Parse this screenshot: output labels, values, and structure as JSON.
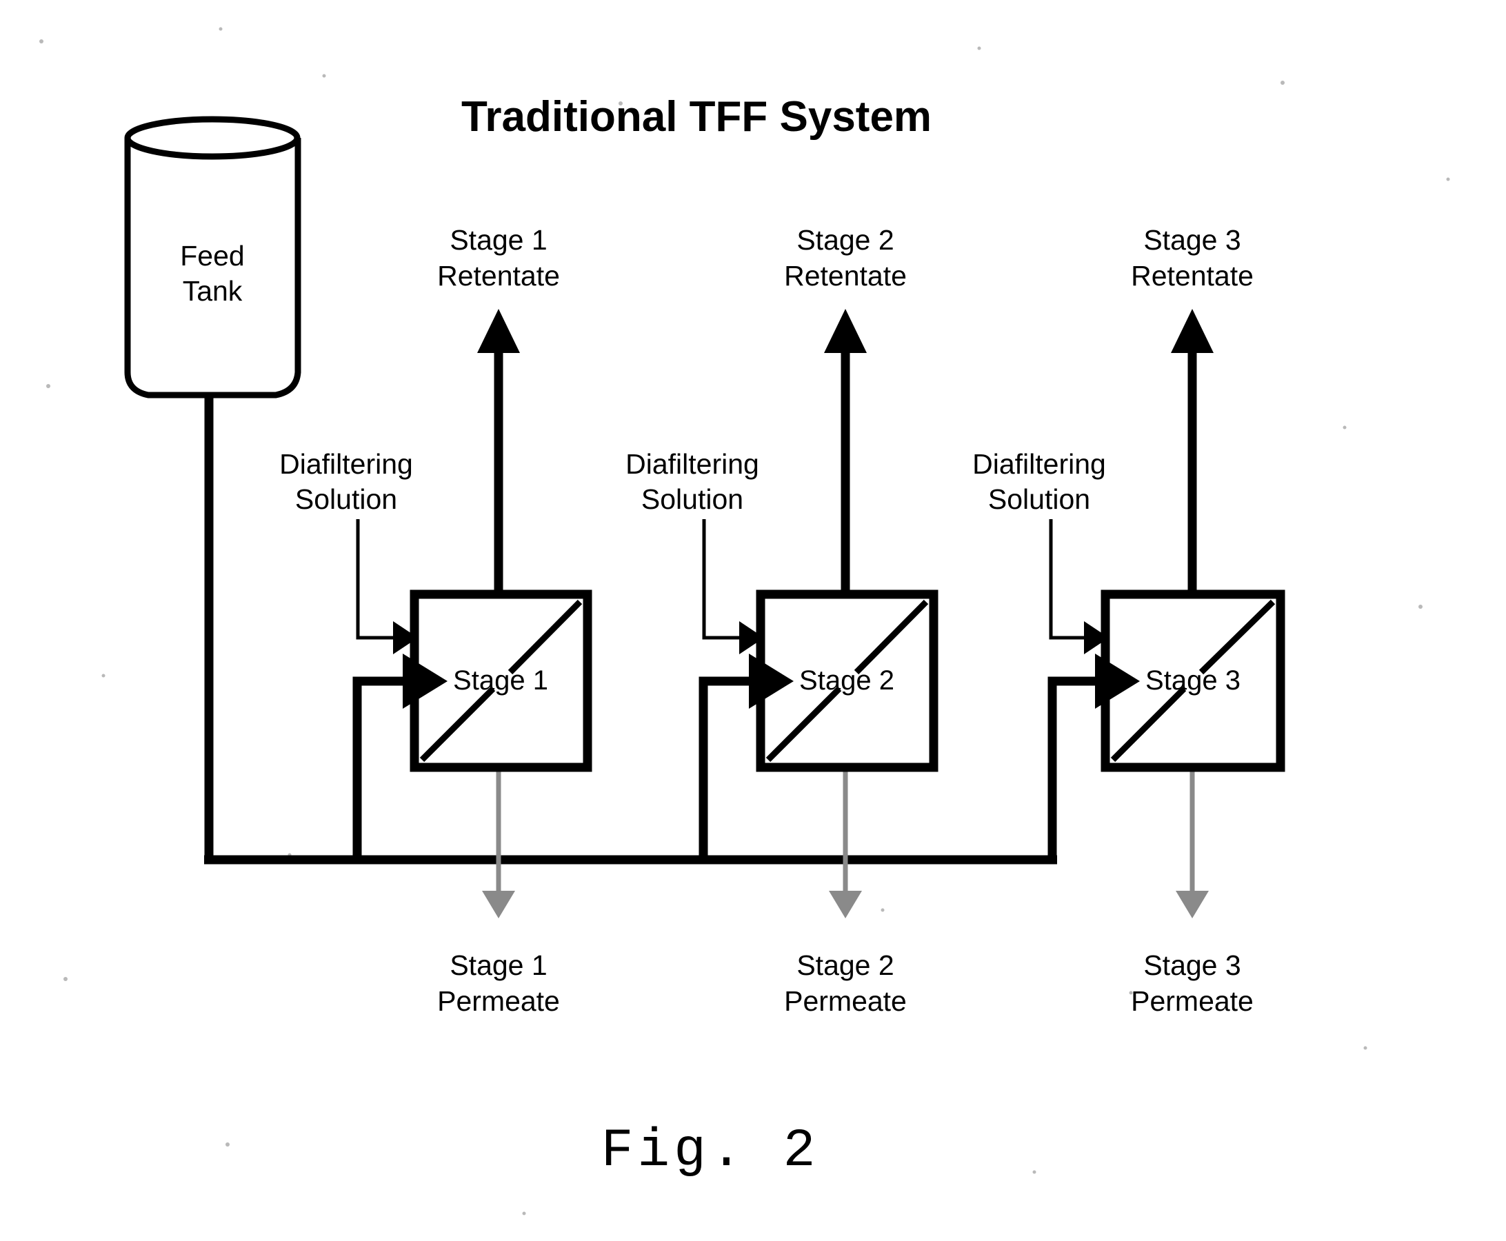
{
  "figure": {
    "title": "Traditional TFF System",
    "caption": "Fig. 2"
  },
  "tank": {
    "name": "feed-tank",
    "label_line1": "Feed",
    "label_line2": "Tank"
  },
  "stages": [
    {
      "id": "stage-1",
      "box_label": "Stage 1",
      "retentate_line1": "Stage 1",
      "retentate_line2": "Retentate",
      "permeate_line1": "Stage 1",
      "permeate_line2": "Permeate",
      "diafilter_line1": "Diafiltering",
      "diafilter_line2": "Solution"
    },
    {
      "id": "stage-2",
      "box_label": "Stage 2",
      "retentate_line1": "Stage 2",
      "retentate_line2": "Retentate",
      "permeate_line1": "Stage 2",
      "permeate_line2": "Permeate",
      "diafilter_line1": "Diafiltering",
      "diafilter_line2": "Solution"
    },
    {
      "id": "stage-3",
      "box_label": "Stage 3",
      "retentate_line1": "Stage 3",
      "retentate_line2": "Retentate",
      "permeate_line1": "Stage 3",
      "permeate_line2": "Permeate",
      "diafilter_line1": "Diafiltering",
      "diafilter_line2": "Solution"
    }
  ],
  "colors": {
    "stroke": "#000000",
    "permeate": "#8a8a8a",
    "background": "#ffffff"
  }
}
